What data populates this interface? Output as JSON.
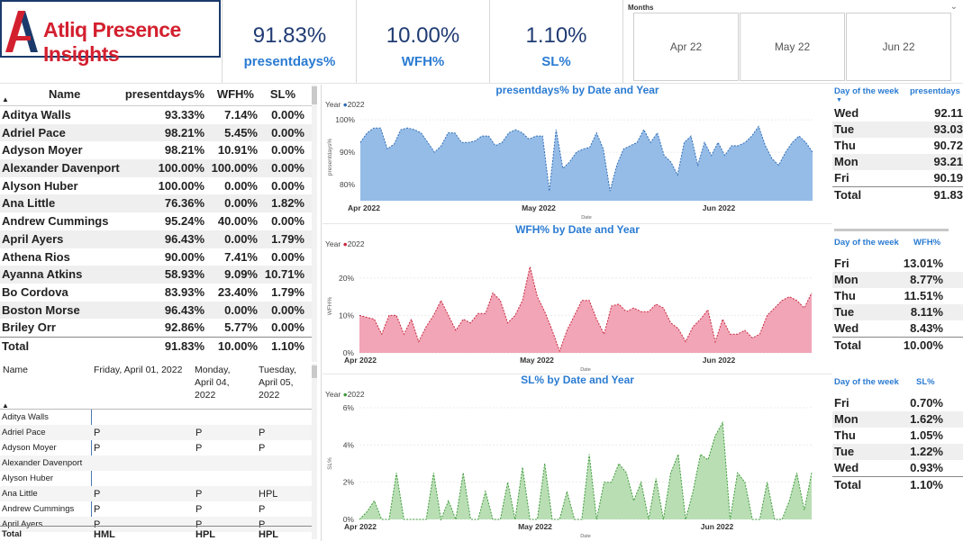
{
  "brand": {
    "name": "Atliq Presence Insights"
  },
  "kpis": [
    {
      "value": "91.83%",
      "label": "presentdays%"
    },
    {
      "value": "10.00%",
      "label": "WFH%"
    },
    {
      "value": "1.10%",
      "label": "SL%"
    }
  ],
  "months": {
    "title": "Months",
    "options": [
      "Apr 22",
      "May 22",
      "Jun 22"
    ]
  },
  "table": {
    "columns": [
      "Name",
      "presentdays%",
      "WFH%",
      "SL%"
    ],
    "rows": [
      [
        "Aditya Walls",
        "93.33%",
        "7.14%",
        "0.00%"
      ],
      [
        "Adriel Pace",
        "98.21%",
        "5.45%",
        "0.00%"
      ],
      [
        "Adyson Moyer",
        "98.21%",
        "10.91%",
        "0.00%"
      ],
      [
        "Alexander Davenport",
        "100.00%",
        "100.00%",
        "0.00%"
      ],
      [
        "Alyson Huber",
        "100.00%",
        "0.00%",
        "0.00%"
      ],
      [
        "Ana Little",
        "76.36%",
        "0.00%",
        "1.82%"
      ],
      [
        "Andrew Cummings",
        "95.24%",
        "40.00%",
        "0.00%"
      ],
      [
        "April Ayers",
        "96.43%",
        "0.00%",
        "1.79%"
      ],
      [
        "Athena Rios",
        "90.00%",
        "7.41%",
        "0.00%"
      ],
      [
        "Ayanna Atkins",
        "58.93%",
        "9.09%",
        "10.71%"
      ],
      [
        "Bo Cordova",
        "83.93%",
        "23.40%",
        "1.79%"
      ],
      [
        "Boston Morse",
        "96.43%",
        "0.00%",
        "0.00%"
      ],
      [
        "Briley Orr",
        "92.86%",
        "5.77%",
        "0.00%"
      ]
    ],
    "total": [
      "Total",
      "91.83%",
      "10.00%",
      "1.10%"
    ]
  },
  "matrix": {
    "col_name": "Name",
    "dates": [
      "Friday, April 01, 2022",
      "Monday,\nApril 04,\n2022",
      "Tuesday,\nApril 05,\n2022"
    ],
    "rows": [
      [
        "Aditya Walls",
        "",
        "",
        ""
      ],
      [
        "Adriel Pace",
        "P",
        "P",
        "P"
      ],
      [
        "Adyson Moyer",
        "P",
        "P",
        "P"
      ],
      [
        "Alexander Davenport",
        "",
        "",
        ""
      ],
      [
        "Alyson Huber",
        "",
        "",
        ""
      ],
      [
        "Ana Little",
        "P",
        "P",
        "HPL"
      ],
      [
        "Andrew Cummings",
        "P",
        "P",
        "P"
      ],
      [
        "April Ayers",
        "P",
        "P",
        "P"
      ],
      [
        "Total",
        "HML",
        "HPL",
        "HPL"
      ]
    ]
  },
  "charts": {
    "present": {
      "title": "presentdays% by Date and Year",
      "legend_label": "Year",
      "legend_item": "2022",
      "ylabel": "presentdays%",
      "xlabel": "Date",
      "yticks": [
        "100%",
        "90%",
        "80%"
      ],
      "xticks": [
        "Apr 2022",
        "May 2022",
        "Jun 2022"
      ],
      "color": "#8fb8e6",
      "line": "#2f6db5"
    },
    "wfh": {
      "title": "WFH% by Date and Year",
      "legend_label": "Year",
      "legend_item": "2022",
      "ylabel": "WFH%",
      "xlabel": "Date",
      "yticks": [
        "20%",
        "10%",
        "0%"
      ],
      "xticks": [
        "Apr 2022",
        "May 2022",
        "Jun 2022"
      ],
      "color": "#f0a0b2",
      "line": "#c8293f"
    },
    "sl": {
      "title": "SL% by Date and Year",
      "legend_label": "Year",
      "legend_item": "2022",
      "ylabel": "SL%",
      "xlabel": "Date",
      "yticks": [
        "6%",
        "4%",
        "2%",
        "0%"
      ],
      "xticks": [
        "Apr 2022",
        "May 2022",
        "Jun 2022"
      ],
      "color": "#b5dcb0",
      "line": "#3e9a3a"
    }
  },
  "chart_data": [
    {
      "type": "area",
      "title": "presentdays% by Date and Year",
      "xlabel": "Date",
      "ylabel": "presentdays%",
      "series": [
        {
          "name": "2022",
          "values": [
            93,
            96,
            97.5,
            97.5,
            91,
            92.5,
            97,
            97.5,
            97,
            96,
            93,
            90,
            92,
            96,
            96,
            93,
            93,
            93.5,
            95,
            95,
            92,
            93,
            96,
            97,
            96,
            94,
            95,
            95,
            78,
            97,
            85,
            87,
            90,
            91,
            91.5,
            96,
            91,
            78,
            86,
            91,
            92,
            93,
            97,
            93,
            96,
            89,
            87,
            83,
            93,
            95,
            86,
            93,
            89,
            93,
            89,
            92,
            92,
            93,
            95,
            98,
            92,
            88,
            86,
            90,
            93,
            95,
            93,
            90
          ]
        }
      ],
      "ylim": [
        75,
        102
      ]
    },
    {
      "type": "area",
      "title": "WFH% by Date and Year",
      "xlabel": "Date",
      "ylabel": "WFH%",
      "series": [
        {
          "name": "2022",
          "values": [
            10,
            9.5,
            9,
            5,
            10,
            10,
            5,
            9,
            3,
            7,
            10,
            14,
            10,
            6,
            9,
            8,
            10.5,
            10.5,
            16,
            14,
            8,
            10,
            14,
            23,
            15,
            11,
            6,
            0.5,
            6,
            10,
            14,
            14,
            9,
            5,
            12.5,
            13,
            11,
            12,
            11,
            11,
            13,
            12,
            8,
            6.5,
            3,
            7,
            9,
            11.5,
            3,
            9,
            5,
            5,
            6,
            4,
            5,
            10,
            12,
            14,
            15,
            14,
            12,
            16
          ]
        }
      ],
      "ylim": [
        0,
        25
      ]
    },
    {
      "type": "area",
      "title": "SL% by Date and Year",
      "xlabel": "Date",
      "ylabel": "SL%",
      "series": [
        {
          "name": "2022",
          "values": [
            0,
            0.4,
            1,
            0,
            0,
            2.5,
            0,
            0,
            0,
            0,
            2.5,
            0,
            1,
            0,
            2.5,
            0,
            0,
            1.5,
            0,
            0,
            2,
            0,
            2.8,
            0,
            0,
            3,
            0,
            0,
            1.5,
            0,
            0,
            3.5,
            0,
            2,
            2,
            3,
            2.5,
            1,
            2,
            0,
            2.2,
            0,
            2.5,
            3.5,
            0,
            1.5,
            3.5,
            3.2,
            4.5,
            5.2,
            0,
            2.5,
            2,
            0,
            0,
            2,
            0,
            0,
            1,
            2.5,
            0.5,
            2.5
          ]
        }
      ],
      "ylim": [
        0,
        6
      ]
    }
  ],
  "dow_tables": [
    {
      "h1": "Day of the week",
      "h2": "presentdays",
      "rows": [
        [
          "Wed",
          "92.11"
        ],
        [
          "Tue",
          "93.03"
        ],
        [
          "Thu",
          "90.72"
        ],
        [
          "Mon",
          "93.21"
        ],
        [
          "Fri",
          "90.19"
        ]
      ],
      "total": [
        "Total",
        "91.83"
      ]
    },
    {
      "h1": "Day of the week",
      "h2": "WFH%",
      "rows": [
        [
          "Fri",
          "13.01%"
        ],
        [
          "Mon",
          "8.77%"
        ],
        [
          "Thu",
          "11.51%"
        ],
        [
          "Tue",
          "8.11%"
        ],
        [
          "Wed",
          "8.43%"
        ]
      ],
      "total": [
        "Total",
        "10.00%"
      ]
    },
    {
      "h1": "Day of the week",
      "h2": "SL%",
      "rows": [
        [
          "Fri",
          "0.70%"
        ],
        [
          "Mon",
          "1.62%"
        ],
        [
          "Thu",
          "1.05%"
        ],
        [
          "Tue",
          "1.22%"
        ],
        [
          "Wed",
          "0.93%"
        ]
      ],
      "total": [
        "Total",
        "1.10%"
      ]
    }
  ]
}
